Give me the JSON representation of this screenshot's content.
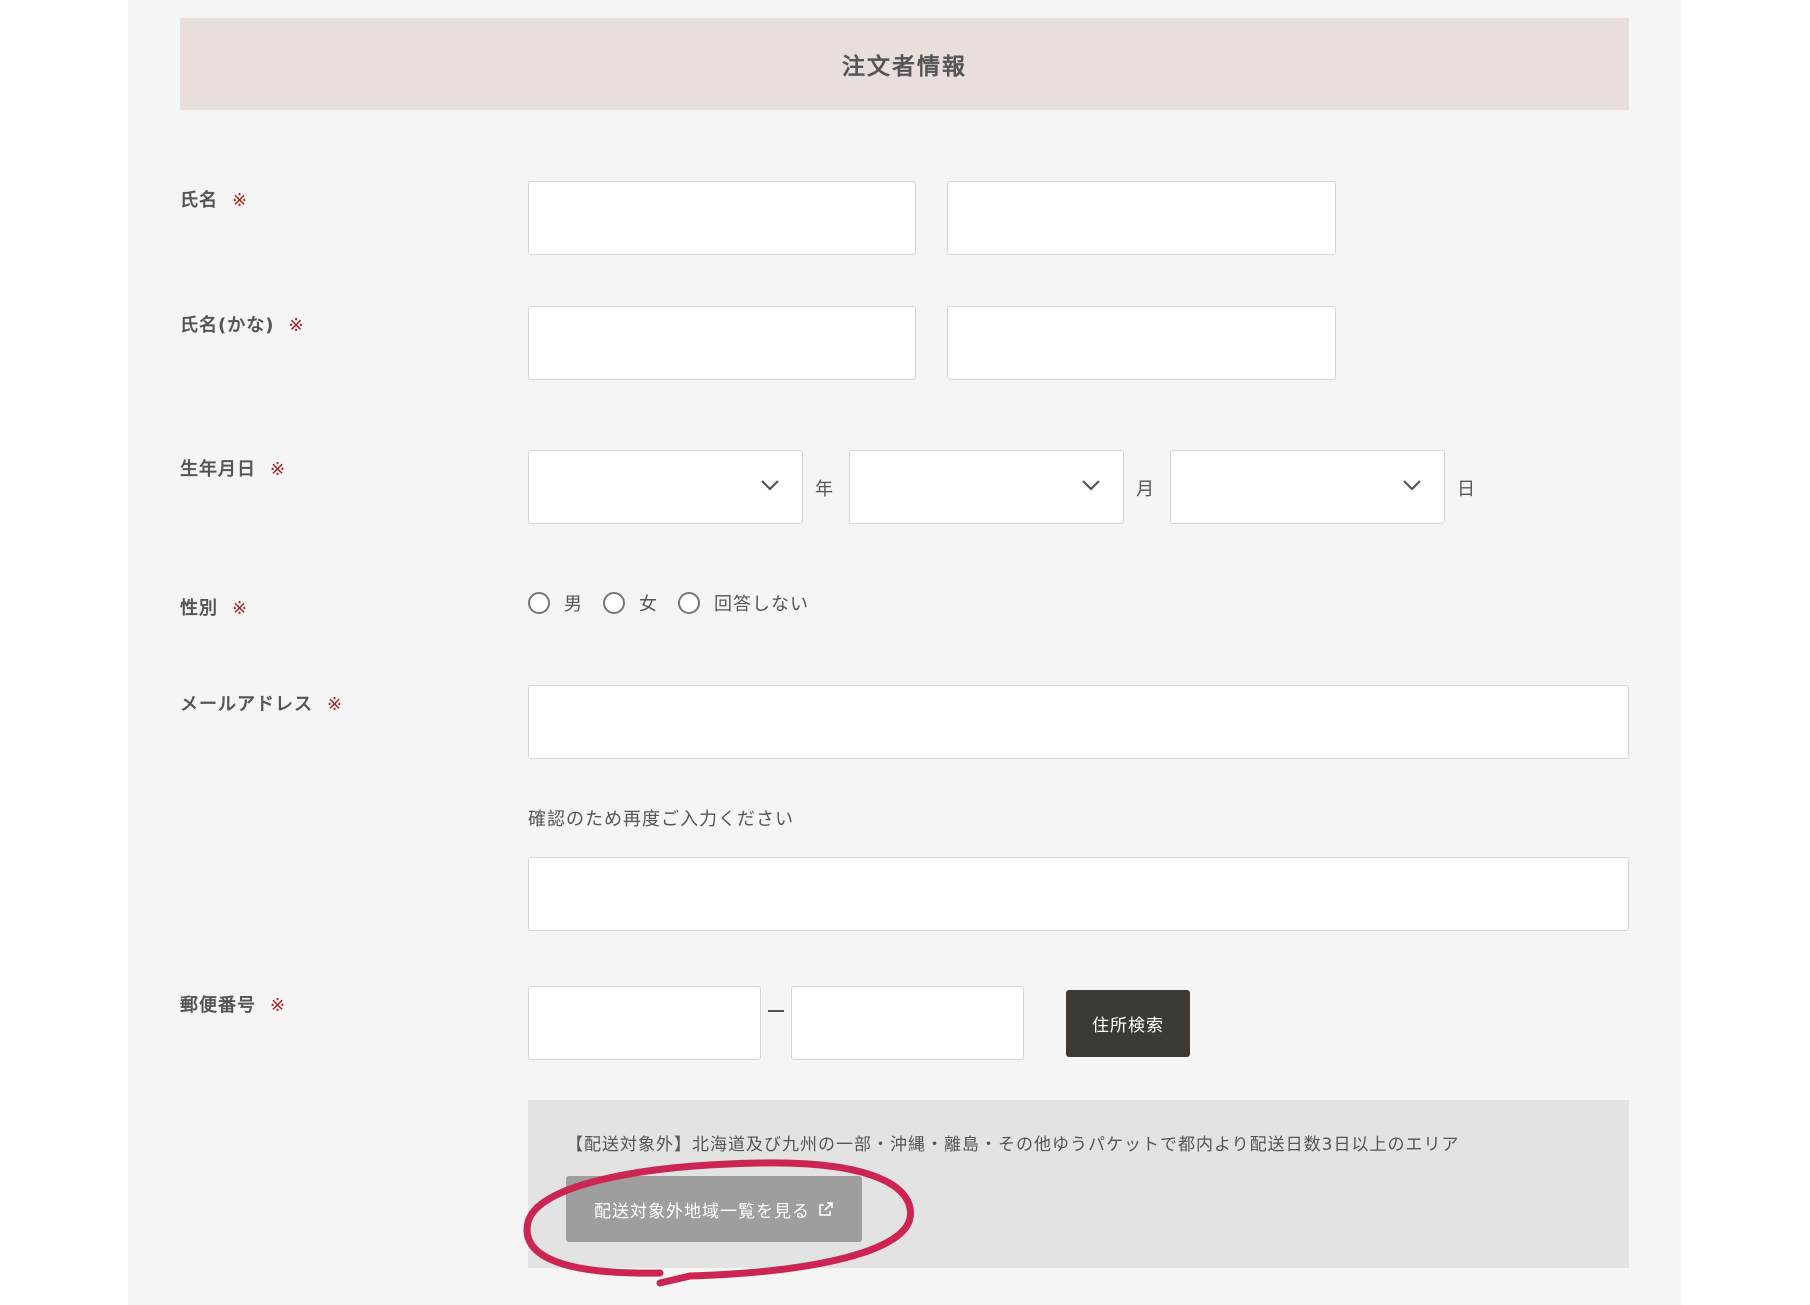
{
  "section": {
    "title": "注文者情報"
  },
  "required_mark": "※",
  "fields": {
    "name": {
      "label": "氏名"
    },
    "name_kana": {
      "label": "氏名(かな)"
    },
    "birthday": {
      "label": "生年月日",
      "year_unit": "年",
      "month_unit": "月",
      "day_unit": "日"
    },
    "gender": {
      "label": "性別",
      "options": [
        "男",
        "女",
        "回答しない"
      ]
    },
    "email": {
      "label": "メールアドレス",
      "confirm_hint": "確認のため再度ご入力ください"
    },
    "postal": {
      "label": "郵便番号",
      "search_button": "住所検索"
    }
  },
  "notice": {
    "text": "【配送対象外】北海道及び九州の一部・沖縄・離島・その他ゆうパケットで都内より配送日数3日以上のエリア",
    "link_button": "配送対象外地域一覧を見る"
  },
  "colors": {
    "header_bg": "#e8dedb",
    "required": "#a8262a",
    "search_button_bg": "#3d3935",
    "link_button_bg": "#9e9e9e",
    "annotation": "#cc2553"
  },
  "icons": {
    "select_arrow": "chevron-down-icon",
    "external_link": "external-link-icon"
  }
}
